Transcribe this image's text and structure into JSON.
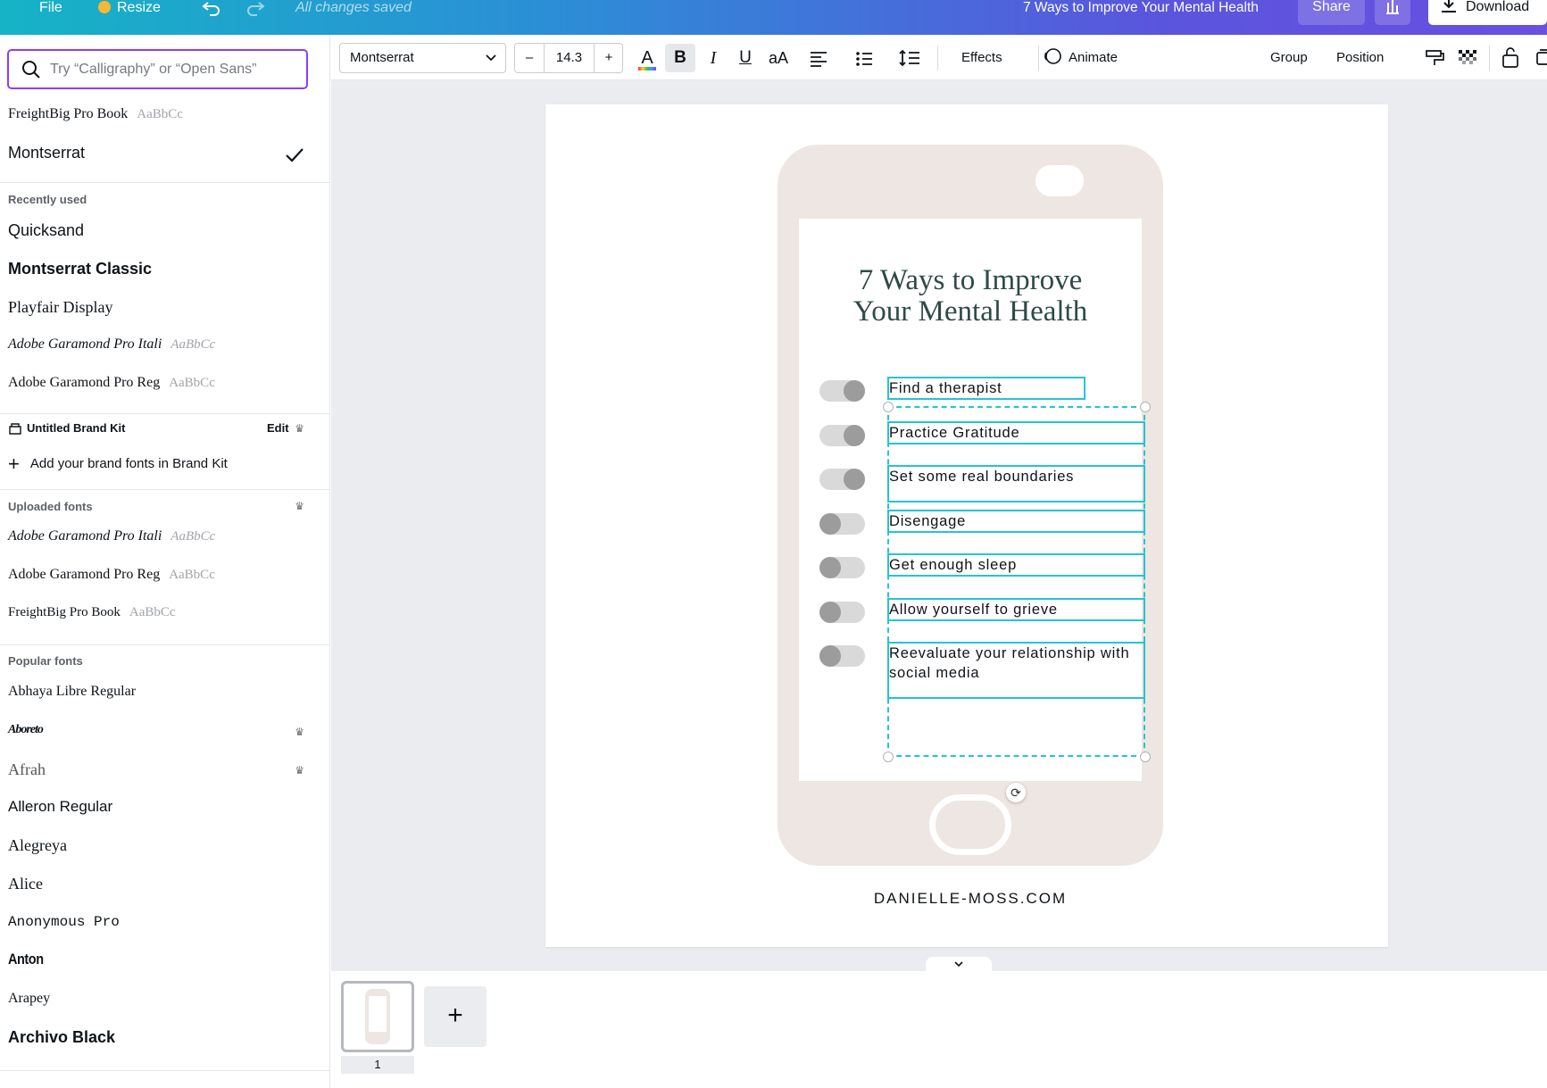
{
  "topbar": {
    "file": "File",
    "resize": "Resize",
    "status": "All changes saved",
    "doc_title": "7 Ways to Improve Your Mental Health",
    "share": "Share",
    "download": "Download"
  },
  "font_panel": {
    "search_placeholder": "Try “Calligraphy” or “Open Sans”",
    "top_items": [
      {
        "name": "FreightBig Pro Book",
        "sample": "AaBbCc"
      },
      {
        "name": "Montserrat",
        "sample": ""
      }
    ],
    "recently_used_heading": "Recently used",
    "recently_used": [
      {
        "name": "Quicksand",
        "sample": ""
      },
      {
        "name": "Montserrat Classic",
        "sample": ""
      },
      {
        "name": "Playfair Display",
        "sample": ""
      },
      {
        "name": "Adobe Garamond Pro Itali",
        "sample": "AaBbCc"
      },
      {
        "name": "Adobe Garamond Pro Reg",
        "sample": "AaBbCc"
      }
    ],
    "brand_kit_heading": "Untitled Brand Kit",
    "brand_kit_edit": "Edit",
    "add_brand_fonts": "Add your brand fonts in Brand Kit",
    "uploaded_heading": "Uploaded fonts",
    "uploaded": [
      {
        "name": "Adobe Garamond Pro Itali",
        "sample": "AaBbCc"
      },
      {
        "name": "Adobe Garamond Pro Reg",
        "sample": "AaBbCc"
      },
      {
        "name": "FreightBig Pro Book",
        "sample": "AaBbCc"
      }
    ],
    "popular_heading": "Popular fonts",
    "popular": [
      {
        "name": "Abhaya Libre Regular",
        "sample": ""
      },
      {
        "name": "Aboreto",
        "sample": ""
      },
      {
        "name": "Afrah",
        "sample": ""
      },
      {
        "name": "Alleron Regular",
        "sample": ""
      },
      {
        "name": "Alegreya",
        "sample": ""
      },
      {
        "name": "Alice",
        "sample": ""
      },
      {
        "name": "Anonymous Pro",
        "sample": ""
      },
      {
        "name": "Anton",
        "sample": ""
      },
      {
        "name": "Arapey",
        "sample": ""
      },
      {
        "name": "Archivo Black",
        "sample": ""
      }
    ]
  },
  "toolbar": {
    "font_name": "Montserrat",
    "decrease": "–",
    "font_size": "14.3",
    "increase": "+",
    "bold": "B",
    "italic": "I",
    "underline": "U",
    "case": "aA",
    "effects": "Effects",
    "animate": "Animate",
    "group": "Group",
    "position": "Position"
  },
  "design": {
    "title_line1": "7 Ways to Improve",
    "title_line2": "Your Mental Health",
    "items": [
      {
        "text": "Find a therapist",
        "toggle_on": true
      },
      {
        "text": "Practice Gratitude",
        "toggle_on": true
      },
      {
        "text": "Set some real boundaries",
        "toggle_on": true
      },
      {
        "text": "Disengage",
        "toggle_on": false
      },
      {
        "text": "Get enough sleep",
        "toggle_on": false
      },
      {
        "text": "Allow yourself to grieve",
        "toggle_on": false
      },
      {
        "text": "Reevaluate your relationship with social media",
        "toggle_on": false
      }
    ],
    "footer": "DANIELLE-MOSS.COM"
  },
  "pages": {
    "current_page": "1",
    "add_page": "+"
  },
  "colors": {
    "accent": "#8b3dff",
    "selection": "#25c4d4",
    "phone": "#ede6e2",
    "title": "#2f4a47"
  }
}
